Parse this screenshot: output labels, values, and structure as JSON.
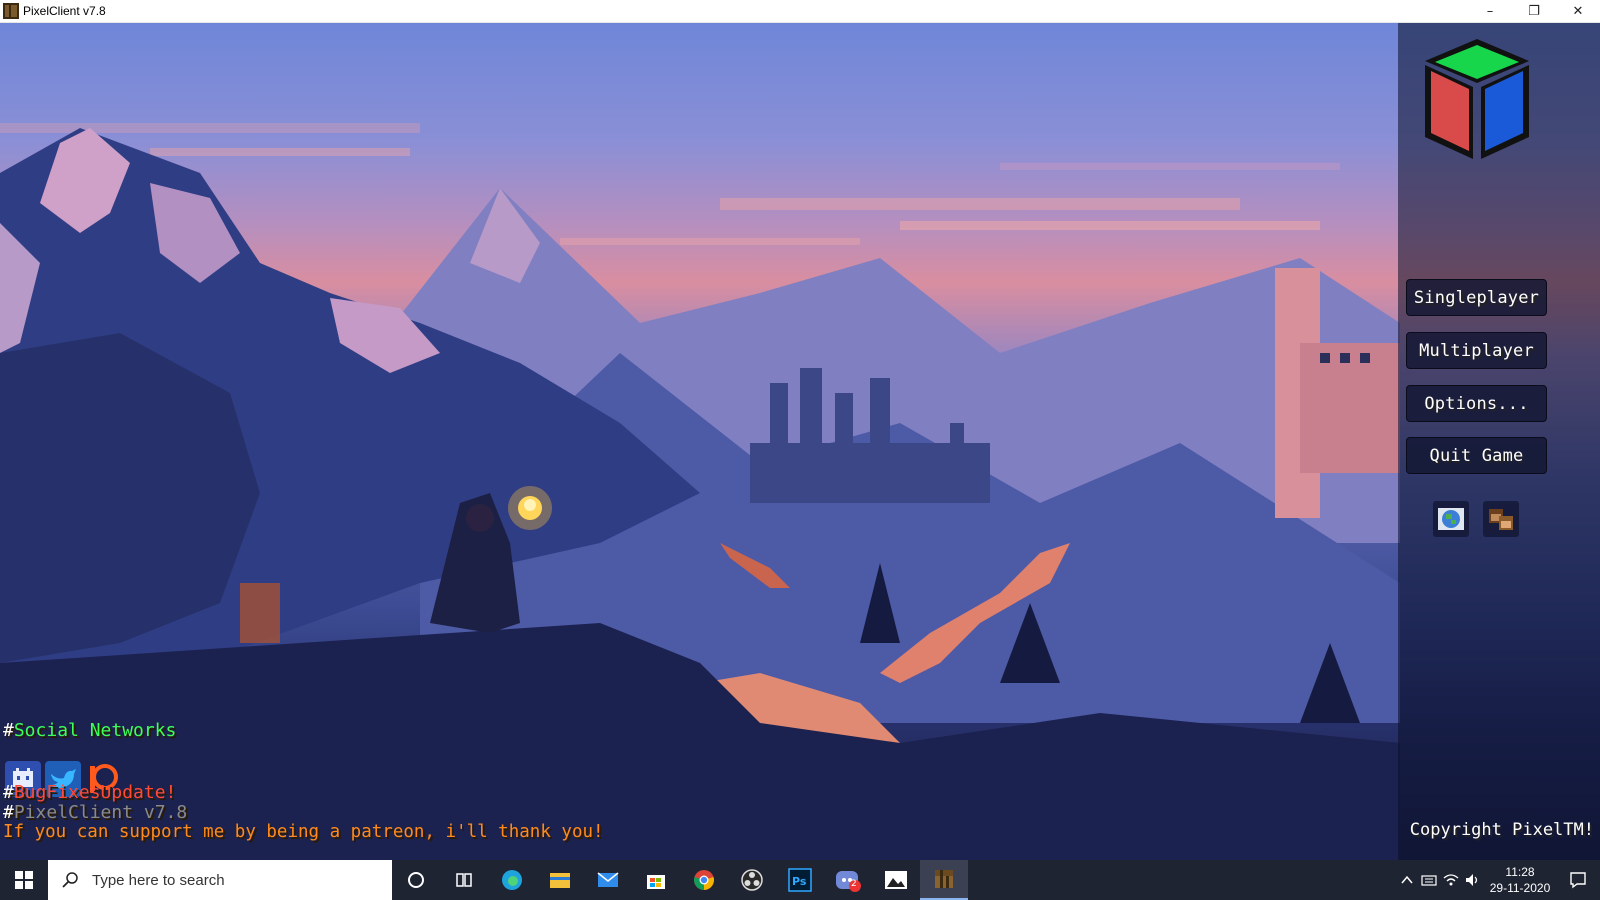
{
  "window": {
    "title": "PixelClient v7.8",
    "minimize": "–",
    "maximize": "❐",
    "close": "✕"
  },
  "menu": {
    "singleplayer": "Singleplayer",
    "multiplayer": "Multiplayer",
    "options": "Options...",
    "quit": "Quit Game"
  },
  "info": {
    "social_hash": "#",
    "social_label": "Social Networks",
    "bugfix_hash": "#",
    "bugfix_label": "BugFixesUpdate!",
    "version_hash": "#",
    "version_label": "PixelClient v7.8",
    "patreon_message": "If you can support me by being a patreon, i'll thank you!",
    "copyright": "Copyright PixelTM!"
  },
  "colors": {
    "social_label": "#3dff5c",
    "bugfix_label": "#ff4a3a",
    "version_label": "#8a8a8a",
    "patreon_message": "#ff8a1e",
    "accent_taskbar": "#8bb3f0"
  },
  "taskbar": {
    "search_placeholder": "Type here to search",
    "time": "11:28",
    "date": "29-11-2020",
    "discord_badge": "2",
    "apps": [
      "cortana-icon",
      "task-view-icon",
      "edge-icon",
      "file-explorer-icon",
      "mail-icon",
      "store-icon",
      "chrome-icon",
      "obs-icon",
      "photoshop-icon",
      "discord-icon",
      "photos-icon",
      "minecraft-icon"
    ]
  }
}
